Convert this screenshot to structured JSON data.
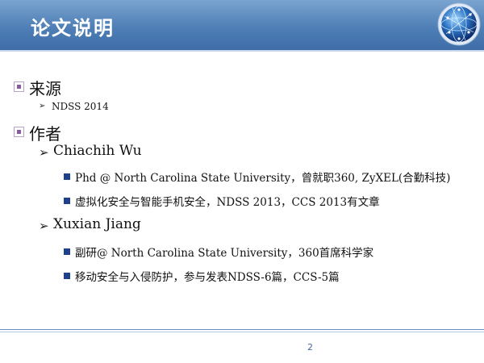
{
  "slide": {
    "title": "论文说明",
    "page_number": "2"
  },
  "sections": {
    "source": {
      "heading": "来源",
      "item": "NDSS 2014"
    },
    "authors": {
      "heading": "作者",
      "author1": {
        "name": "Chiachih Wu",
        "details": [
          "Phd @  North Carolina State University，曾就职360, ZyXEL(合勤科技)",
          "虚拟化安全与智能手机安全，NDSS 2013，CCS 2013有文章"
        ]
      },
      "author2": {
        "name": "Xuxian Jiang",
        "details": [
          "副研@  North Carolina State University，360首席科学家",
          "移动安全与入侵防护，参与发表NDSS-6篇，CCS-5篇"
        ]
      }
    }
  }
}
